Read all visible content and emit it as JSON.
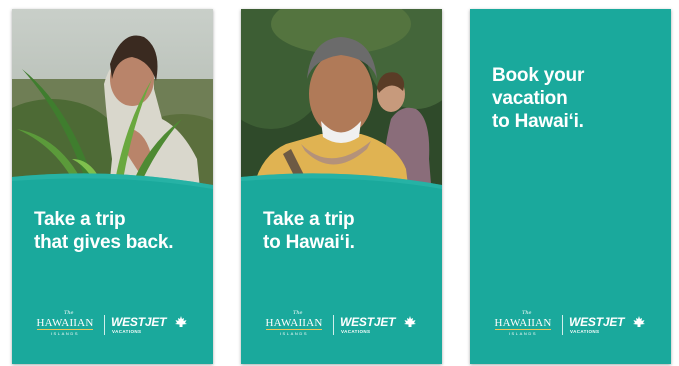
{
  "panels": [
    {
      "headline": [
        "Take a trip",
        "that gives back."
      ],
      "image": "woman-tending-plants-photo"
    },
    {
      "headline": [
        "Take a trip",
        "to Hawaiʻi."
      ],
      "image": "smiling-man-with-lei-photo"
    },
    {
      "headline": [
        "Book your",
        "vacation",
        "to Hawaiʻi."
      ],
      "image": ""
    }
  ],
  "logos": {
    "hawaiian_the": "The",
    "hawaiian_main": "HAWAIIAN",
    "hawaiian_sub": "ISLANDS",
    "westjet_main": "WESTJET",
    "westjet_sub": "VACATIONS",
    "westjet_icon": "maple-leaf-icon"
  },
  "colors": {
    "brand_teal": "#1aa99c",
    "text": "#ffffff",
    "accent_gold": "#e9c65b"
  }
}
